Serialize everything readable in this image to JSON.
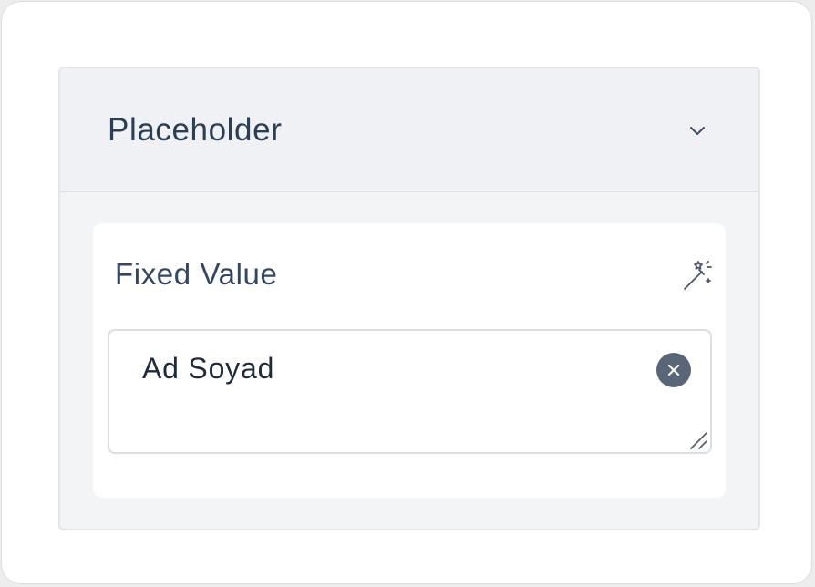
{
  "section": {
    "title": "Placeholder",
    "toggle_icon": "chevron-down-icon",
    "expanded": true
  },
  "field": {
    "label": "Fixed Value",
    "magic_icon": "magic-wand-icon",
    "value": "Ad Soyad",
    "clear_icon": "clear-icon",
    "resize_icon": "resize-handle-icon"
  },
  "colors": {
    "text_primary": "#2c3e55",
    "value_text": "#1f2a3b",
    "clear_button": "#5b6578",
    "panel_bg": "#f3f4f6"
  }
}
